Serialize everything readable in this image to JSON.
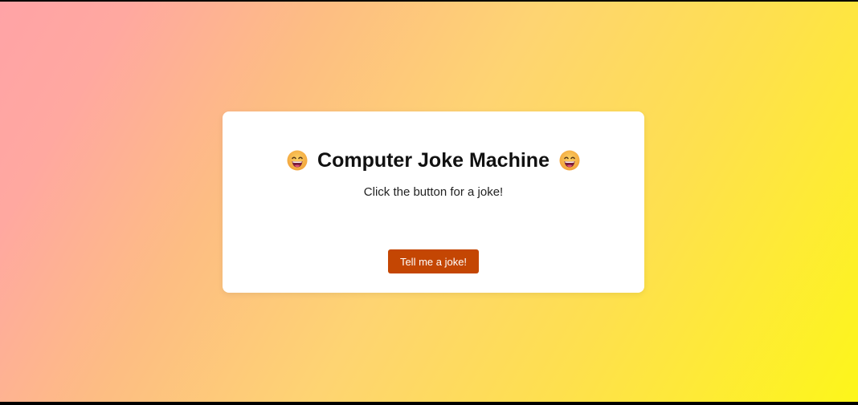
{
  "header": {
    "title": "Computer Joke Machine",
    "left_icon": "grinning-face-emoji",
    "right_icon": "grinning-face-emoji"
  },
  "prompt_text": "Click the button for a joke!",
  "button": {
    "label": "Tell me a joke!",
    "color": "#c44603"
  },
  "colors": {
    "background_gradient_start": "#ffa3a6",
    "background_gradient_end": "#fdf61a",
    "card": "#ffffff"
  }
}
